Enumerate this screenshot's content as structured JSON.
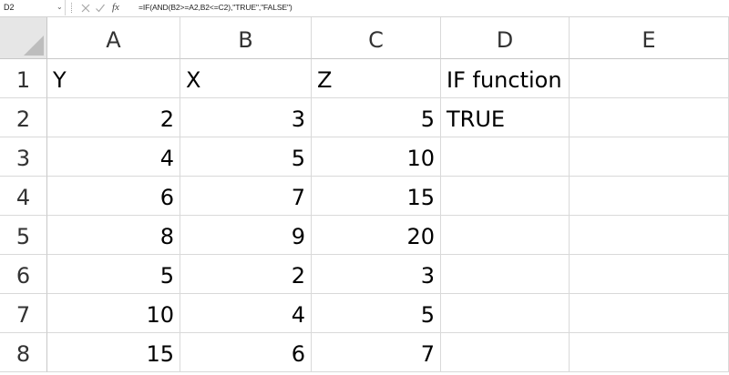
{
  "name_box": "D2",
  "formula": "=IF(AND(B2>=A2,B2<=C2),\"TRUE\",\"FALSE\")",
  "icons": {
    "cancel": "cancel-icon",
    "enter": "enter-icon",
    "function": "fx-icon"
  },
  "fx_label": "fx",
  "columns": [
    "A",
    "B",
    "C",
    "D",
    "E"
  ],
  "rows": [
    {
      "num": "1",
      "cells": [
        "Y",
        "X",
        "Z",
        "IF function",
        ""
      ]
    },
    {
      "num": "2",
      "cells": [
        "2",
        "3",
        "5",
        "TRUE",
        ""
      ]
    },
    {
      "num": "3",
      "cells": [
        "4",
        "5",
        "10",
        "",
        ""
      ]
    },
    {
      "num": "4",
      "cells": [
        "6",
        "7",
        "15",
        "",
        ""
      ]
    },
    {
      "num": "5",
      "cells": [
        "8",
        "9",
        "20",
        "",
        ""
      ]
    },
    {
      "num": "6",
      "cells": [
        "5",
        "2",
        "3",
        "",
        ""
      ]
    },
    {
      "num": "7",
      "cells": [
        "10",
        "4",
        "5",
        "",
        ""
      ]
    },
    {
      "num": "8",
      "cells": [
        "15",
        "6",
        "7",
        "",
        ""
      ]
    }
  ]
}
